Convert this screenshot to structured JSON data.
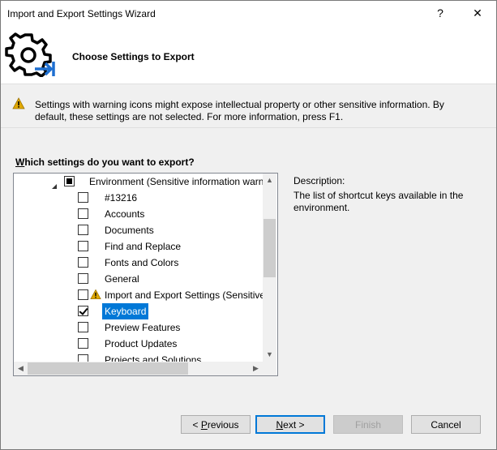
{
  "window": {
    "title": "Import and Export Settings Wizard",
    "help_button": "?",
    "close_button": "✕"
  },
  "header": {
    "title": "Choose Settings to Export"
  },
  "warning": {
    "text": "Settings with warning icons might expose intellectual property or other sensitive information. By default, these settings are not selected. For more information, press F1."
  },
  "settings_section": {
    "label": "Which settings do you want to export?",
    "tree": {
      "root": {
        "label": "Environment (Sensitive information warn",
        "state": "partial",
        "expanded": true
      },
      "items": [
        {
          "label": "#13216",
          "checked": false,
          "warning": false
        },
        {
          "label": "Accounts",
          "checked": false,
          "warning": false
        },
        {
          "label": "Documents",
          "checked": false,
          "warning": false
        },
        {
          "label": "Find and Replace",
          "checked": false,
          "warning": false
        },
        {
          "label": "Fonts and Colors",
          "checked": false,
          "warning": false
        },
        {
          "label": "General",
          "checked": false,
          "warning": false
        },
        {
          "label": "Import and Export Settings (Sensitive",
          "checked": false,
          "warning": true
        },
        {
          "label": "Keyboard",
          "checked": true,
          "warning": false,
          "selected": true
        },
        {
          "label": "Preview Features",
          "checked": false,
          "warning": false
        },
        {
          "label": "Product Updates",
          "checked": false,
          "warning": false
        },
        {
          "label": "Projects and Solutions",
          "checked": false,
          "warning": false
        }
      ]
    }
  },
  "description": {
    "label": "Description:",
    "text": "The list of shortcut keys available in the environment."
  },
  "buttons": {
    "previous": "< Previous",
    "next": "Next >",
    "finish": "Finish",
    "cancel": "Cancel"
  },
  "colors": {
    "accent": "#0078d7",
    "warning": "#e0a800"
  }
}
